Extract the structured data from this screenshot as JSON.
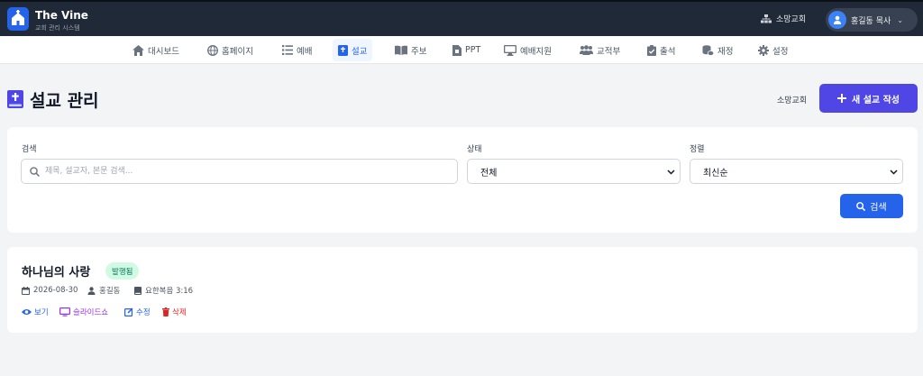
{
  "header": {
    "brand_name": "The Vine",
    "brand_sub": "교회 관리 시스템",
    "church_name": "소망교회",
    "user_name": "홍길동 목사"
  },
  "nav": {
    "items": [
      {
        "label": "대시보드",
        "icon": "home-icon"
      },
      {
        "label": "홈페이지",
        "icon": "globe-icon"
      },
      {
        "label": "예배",
        "icon": "list-icon"
      },
      {
        "label": "설교",
        "icon": "bible-icon",
        "active": true
      },
      {
        "label": "주보",
        "icon": "book-open-icon"
      },
      {
        "label": "PPT",
        "icon": "file-icon"
      },
      {
        "label": "예배지원",
        "icon": "monitor-icon"
      },
      {
        "label": "교적부",
        "icon": "users-icon"
      },
      {
        "label": "출석",
        "icon": "clipboard-check-icon"
      },
      {
        "label": "재정",
        "icon": "coins-icon"
      },
      {
        "label": "설정",
        "icon": "gear-icon"
      }
    ]
  },
  "page": {
    "title": "설교 관리",
    "church": "소망교회",
    "new_button": "새 설교 작성"
  },
  "filters": {
    "search_label": "검색",
    "search_placeholder": "제목, 설교자, 본문 검색...",
    "status_label": "상태",
    "status_value": "전체",
    "sort_label": "정렬",
    "sort_value": "최신순",
    "search_button": "검색"
  },
  "sermons": [
    {
      "title": "하나님의 사랑",
      "status": "발행됨",
      "date": "2026-08-30",
      "preacher": "홍길동",
      "scripture": "요한복음 3:16",
      "actions": {
        "view": "보기",
        "slides": "슬라이드쇼",
        "edit": "수정",
        "delete": "삭제"
      }
    }
  ],
  "colors": {
    "topbar": "#1f2937",
    "primary": "#2563eb",
    "indigo": "#4f46e5",
    "badge_bg": "#d1fae5",
    "badge_text": "#047857",
    "slides": "#9333ea",
    "delete": "#dc2626"
  }
}
